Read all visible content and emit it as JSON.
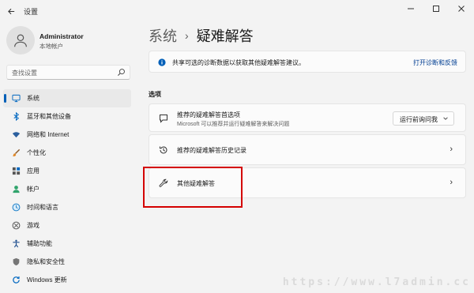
{
  "window": {
    "title": "设置",
    "controls": [
      "minimize",
      "maximize",
      "close"
    ]
  },
  "user": {
    "name": "Administrator",
    "account_type": "本地帐户"
  },
  "search": {
    "placeholder": "查找设置"
  },
  "sidebar": {
    "items": [
      {
        "label": "系统",
        "icon": "monitor-icon",
        "active": true
      },
      {
        "label": "蓝牙和其他设备",
        "icon": "bluetooth-icon"
      },
      {
        "label": "网络和 Internet",
        "icon": "wifi-icon"
      },
      {
        "label": "个性化",
        "icon": "brush-icon"
      },
      {
        "label": "应用",
        "icon": "apps-icon"
      },
      {
        "label": "帐户",
        "icon": "person-icon"
      },
      {
        "label": "时间和语言",
        "icon": "globe-clock-icon"
      },
      {
        "label": "游戏",
        "icon": "xbox-icon"
      },
      {
        "label": "辅助功能",
        "icon": "accessibility-icon"
      },
      {
        "label": "隐私和安全性",
        "icon": "shield-icon"
      },
      {
        "label": "Windows 更新",
        "icon": "update-icon"
      }
    ]
  },
  "breadcrumb": {
    "parent": "系统",
    "separator": "›",
    "current": "疑难解答"
  },
  "info": {
    "text": "共享可选的诊断数据以获取其他疑难解答建议。",
    "link": "打开诊断和反馈"
  },
  "section": {
    "title": "选项"
  },
  "cards": {
    "preferences": {
      "title": "推荐的疑难解答首选项",
      "subtitle": "Microsoft 可以推荐并运行疑难解答来解决问题",
      "dropdown_value": "运行前询问我"
    },
    "history": {
      "title": "推荐的疑难解答历史记录"
    },
    "other": {
      "title": "其他疑难解答"
    }
  },
  "colors": {
    "accent": "#005fb8",
    "highlight": "#d40000",
    "background": "#f3f3f3",
    "card": "#fbfbfb"
  },
  "watermark": "https://www.l7admin.cc"
}
